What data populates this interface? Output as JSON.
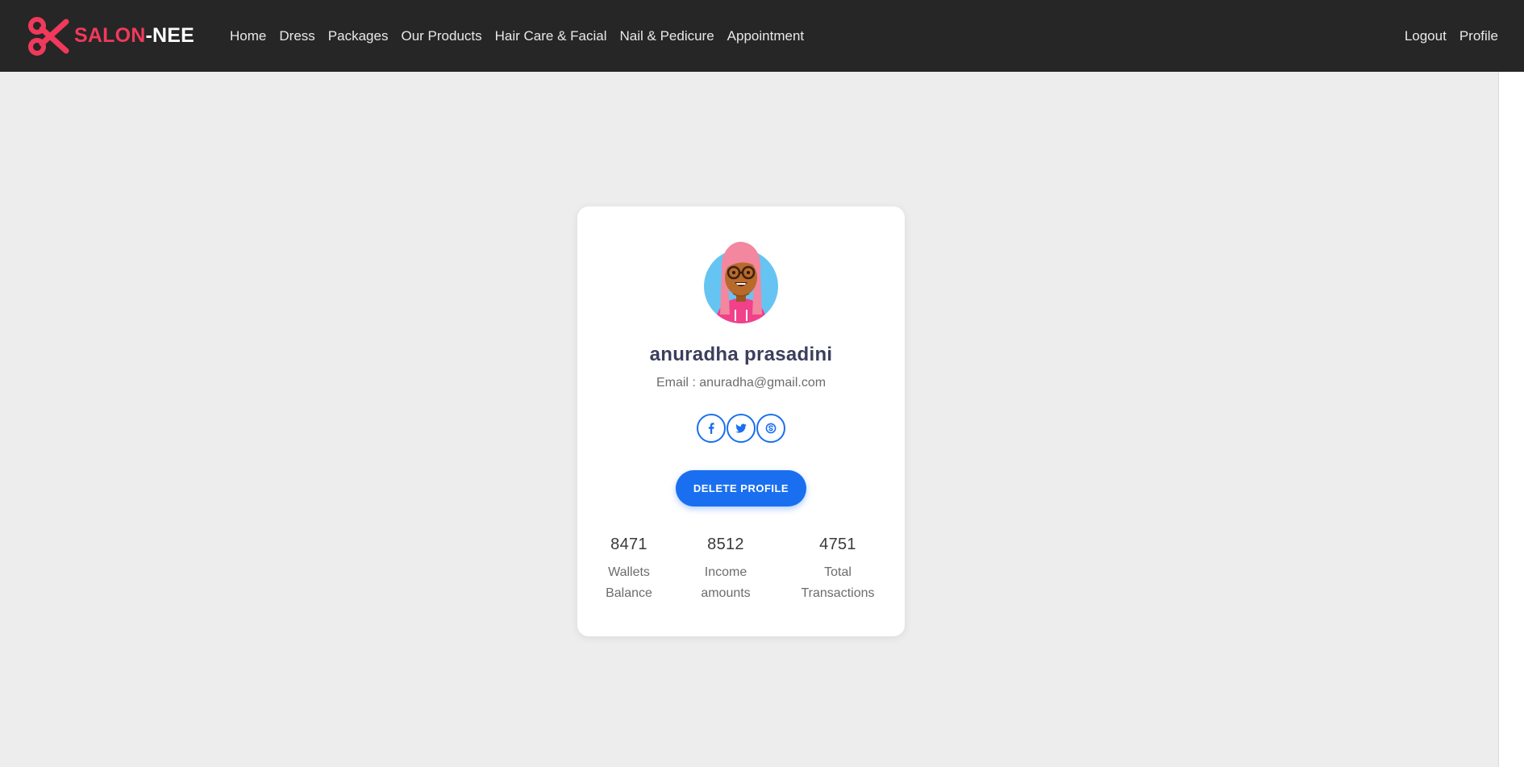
{
  "brand": {
    "accent_text": "SALON",
    "rest_text": "-NEE",
    "logo_icon": "scissors-icon",
    "accent_color": "#f1395b"
  },
  "nav": {
    "items": [
      {
        "label": "Home"
      },
      {
        "label": "Dress"
      },
      {
        "label": "Packages"
      },
      {
        "label": "Our Products"
      },
      {
        "label": "Hair Care & Facial"
      },
      {
        "label": "Nail & Pedicure"
      },
      {
        "label": "Appointment"
      }
    ],
    "right_items": [
      {
        "label": "Logout"
      },
      {
        "label": "Profile"
      }
    ]
  },
  "profile": {
    "avatar_icon": "avatar-illustration",
    "name": "anuradha prasadini",
    "email_line": "Email : anuradha@gmail.com",
    "socials": [
      {
        "icon": "facebook-icon"
      },
      {
        "icon": "twitter-icon"
      },
      {
        "icon": "skype-icon"
      }
    ],
    "delete_label": "DELETE PROFILE",
    "button_color": "#1a6ff0",
    "stats": [
      {
        "value": "8471",
        "label_line1": "Wallets",
        "label_line2": "Balance"
      },
      {
        "value": "8512",
        "label_line1": "Income",
        "label_line2": "amounts"
      },
      {
        "value": "4751",
        "label_line1": "Total",
        "label_line2": "Transactions"
      }
    ]
  }
}
